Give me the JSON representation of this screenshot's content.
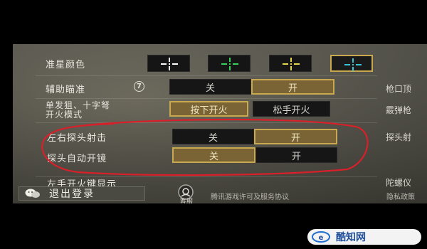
{
  "settings": {
    "crosshair_color": {
      "label": "准星颜色",
      "options": [
        {
          "color": "#ffffff",
          "selected": false
        },
        {
          "color": "#35d25b",
          "selected": false
        },
        {
          "color": "#e7d64a",
          "selected": false
        },
        {
          "color": "#39c4d6",
          "selected": true
        }
      ]
    },
    "aim_assist": {
      "label": "辅助瞄准",
      "help_icon": "7",
      "off": "关",
      "on": "开",
      "value": "开"
    },
    "fire_mode": {
      "label_line1": "单发狙、十字弩",
      "label_line2": "开火模式",
      "option_press": "按下开火",
      "option_release": "松手开火",
      "value": "按下开火"
    },
    "peek_shoot": {
      "label": "左右探头射击",
      "off": "关",
      "on": "开",
      "value": "开"
    },
    "peek_auto_scope": {
      "label": "探头自动开镜",
      "off": "关",
      "on": "开",
      "value": "关"
    },
    "left_fire_display": {
      "label": "左手开火键显示"
    }
  },
  "right_column": {
    "item1": "枪口顶",
    "item2": "霰弹枪",
    "item3": "探头射",
    "item4": "陀螺仪"
  },
  "footer": {
    "logout": "退出登录",
    "customer_service": "客服",
    "agreement": "腾讯游戏许可及服务协议",
    "privacy": "隐私政策"
  },
  "watermark": {
    "text": "酷知网"
  },
  "colors": {
    "accent_gold": "#c9a94f",
    "annotation_red": "#d8202a"
  }
}
